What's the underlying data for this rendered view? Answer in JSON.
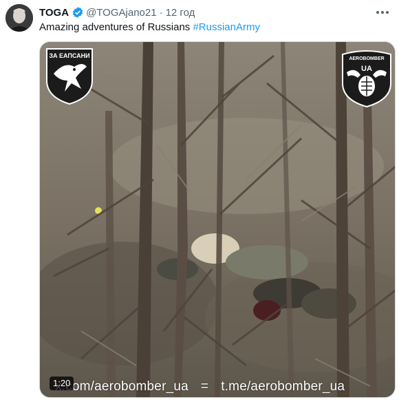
{
  "author": {
    "name": "TOGA",
    "handle": "@TOGAjano21",
    "separator": "·",
    "time": "12 год"
  },
  "tweet": {
    "text": "Amazing adventures of Russians ",
    "hashtag": "#RussianArmy"
  },
  "media": {
    "badge_left_text": "ЗА ЕАПСАНИ",
    "badge_right_text": "AEROBOMBER",
    "badge_right_sub": "UA",
    "duration": "1:20",
    "watermark_left": "x.com/aerobomber_ua",
    "watermark_sep": "=",
    "watermark_right": "t.me/aerobomber_ua"
  },
  "colors": {
    "accent": "#1d9bf0",
    "muted": "#536471"
  }
}
